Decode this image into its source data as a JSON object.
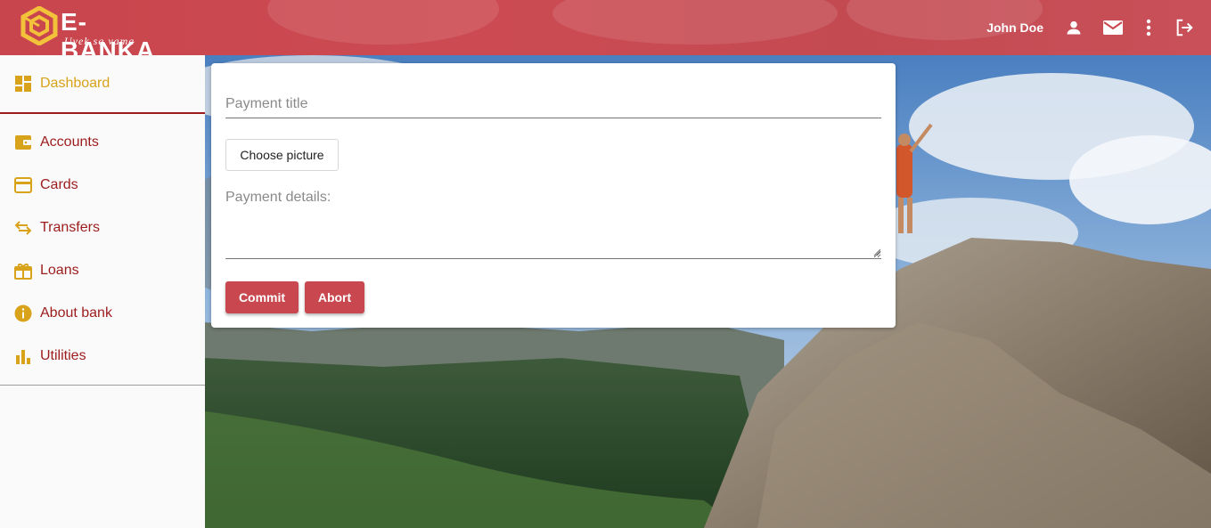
{
  "header": {
    "brand": "E-BANKA",
    "slogan": "Uvek sa vama",
    "user_name": "John Doe",
    "icons": [
      "person-icon",
      "mail-icon",
      "more-vert-icon",
      "logout-icon"
    ]
  },
  "sidebar": {
    "items": [
      {
        "label": "Dashboard",
        "icon": "dashboard-icon",
        "active": true
      },
      {
        "label": "Accounts",
        "icon": "wallet-icon"
      },
      {
        "label": "Cards",
        "icon": "credit-card-icon"
      },
      {
        "label": "Transfers",
        "icon": "swap-arrows-icon"
      },
      {
        "label": "Loans",
        "icon": "gift-box-icon"
      },
      {
        "label": "About bank",
        "icon": "info-icon"
      },
      {
        "label": "Utilities",
        "icon": "bar-chart-icon"
      }
    ]
  },
  "form": {
    "title_placeholder": "Payment title",
    "title_value": "",
    "choose_picture_label": "Choose picture",
    "details_label": "Payment details:",
    "details_value": "",
    "commit_label": "Commit",
    "abort_label": "Abort"
  },
  "colors": {
    "header": "#c9474e",
    "sidebar_text": "#9c1c1c",
    "active": "#d8a31a",
    "button": "#c9474e"
  }
}
